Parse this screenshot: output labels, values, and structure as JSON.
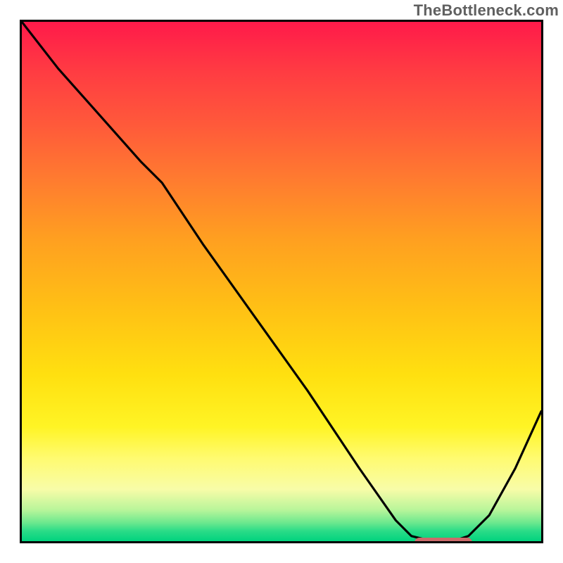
{
  "attribution": "TheBottleneck.com",
  "chart_data": {
    "type": "line",
    "title": "",
    "xlabel": "",
    "ylabel": "",
    "xlim": [
      0,
      100
    ],
    "ylim": [
      0,
      100
    ],
    "grid": false,
    "legend": false,
    "background": "vertical-gradient-red-yellow-green",
    "series": [
      {
        "name": "bottleneck-curve",
        "x": [
          0,
          7,
          15,
          23,
          27,
          35,
          45,
          55,
          65,
          72,
          75,
          79,
          83,
          86,
          90,
          95,
          100
        ],
        "y": [
          100,
          91,
          82,
          73,
          69,
          57,
          43,
          29,
          14,
          4,
          1,
          0,
          0,
          1,
          5,
          14,
          25
        ]
      }
    ],
    "marker": {
      "name": "optimal-range",
      "x_start": 75,
      "x_end": 86,
      "y": 0.6
    },
    "colors": {
      "top": "#ff1a4a",
      "mid": "#ffe010",
      "bottom": "#00d37e",
      "curve": "#000000",
      "marker": "#cc6a6a"
    }
  }
}
